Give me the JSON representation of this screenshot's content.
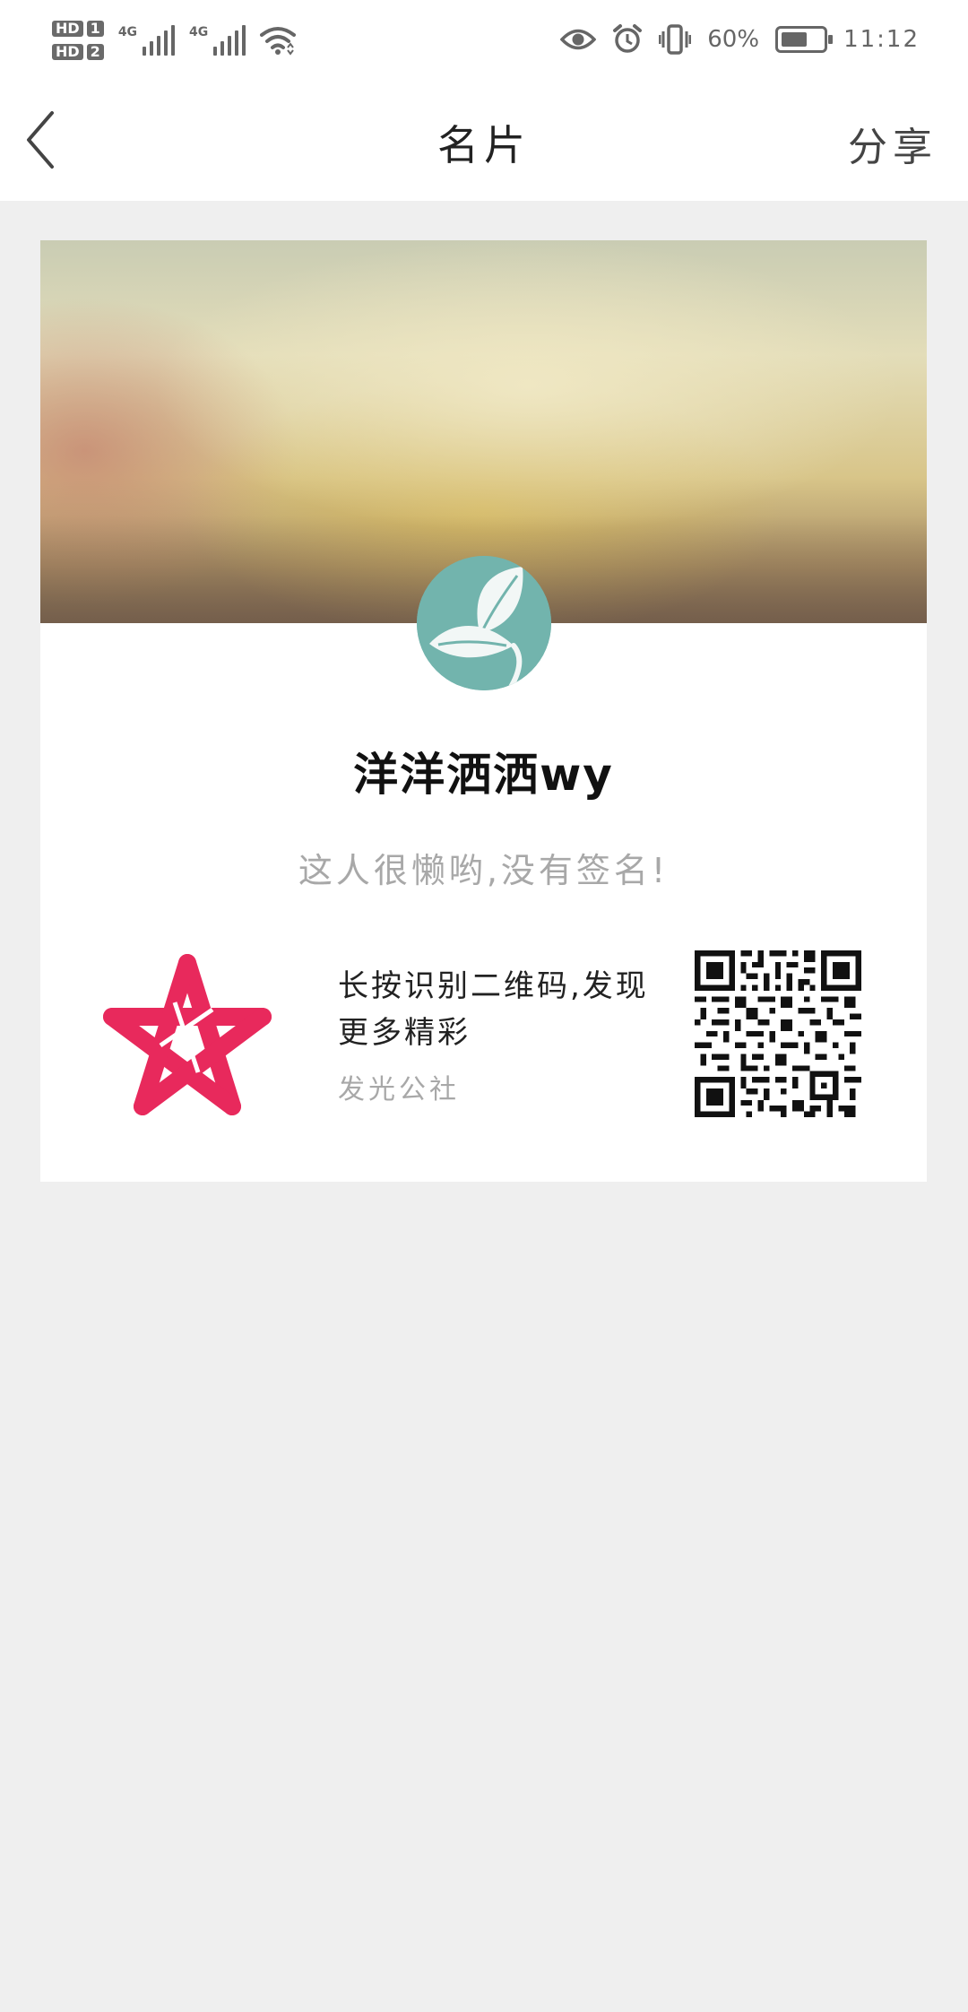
{
  "status_bar": {
    "hd1": "HD",
    "hd1_sim": "1",
    "hd2": "HD",
    "hd2_sim": "2",
    "net1": "4G",
    "net2": "4G",
    "battery_percent": "60%",
    "time": "11:12",
    "icons": [
      "eye-icon",
      "alarm-icon",
      "vibrate-icon",
      "wifi-icon",
      "battery-icon"
    ]
  },
  "header": {
    "title": "名片",
    "share_label": "分享"
  },
  "card": {
    "username": "洋洋洒洒wy",
    "signature": "这人很懒哟,没有签名!",
    "promo_text": "长按识别二维码,发现更多精彩",
    "org_name": "发光公社",
    "colors": {
      "brand_red": "#e8295c",
      "avatar_teal": "#72b4ad"
    }
  }
}
